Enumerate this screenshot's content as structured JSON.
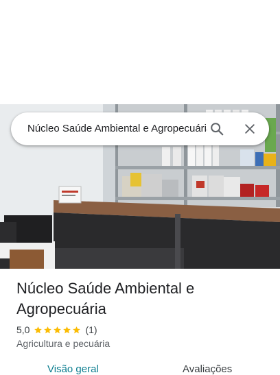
{
  "search": {
    "query": "Núcleo Saúde Ambiental e Agropecuária"
  },
  "icons": {
    "search": "search-icon",
    "close": "close-icon",
    "star": "star-icon"
  },
  "place": {
    "name": "Núcleo Saúde Ambiental e Agropecuária",
    "rating": "5,0",
    "stars": 5,
    "review_count": "(1)",
    "category": "Agricultura e pecuária"
  },
  "tabs": [
    {
      "label": "Visão geral",
      "selected": true
    },
    {
      "label": "Avaliações",
      "selected": false
    }
  ],
  "colors": {
    "star": "#fbbc04",
    "accent": "#0b7d8f"
  }
}
